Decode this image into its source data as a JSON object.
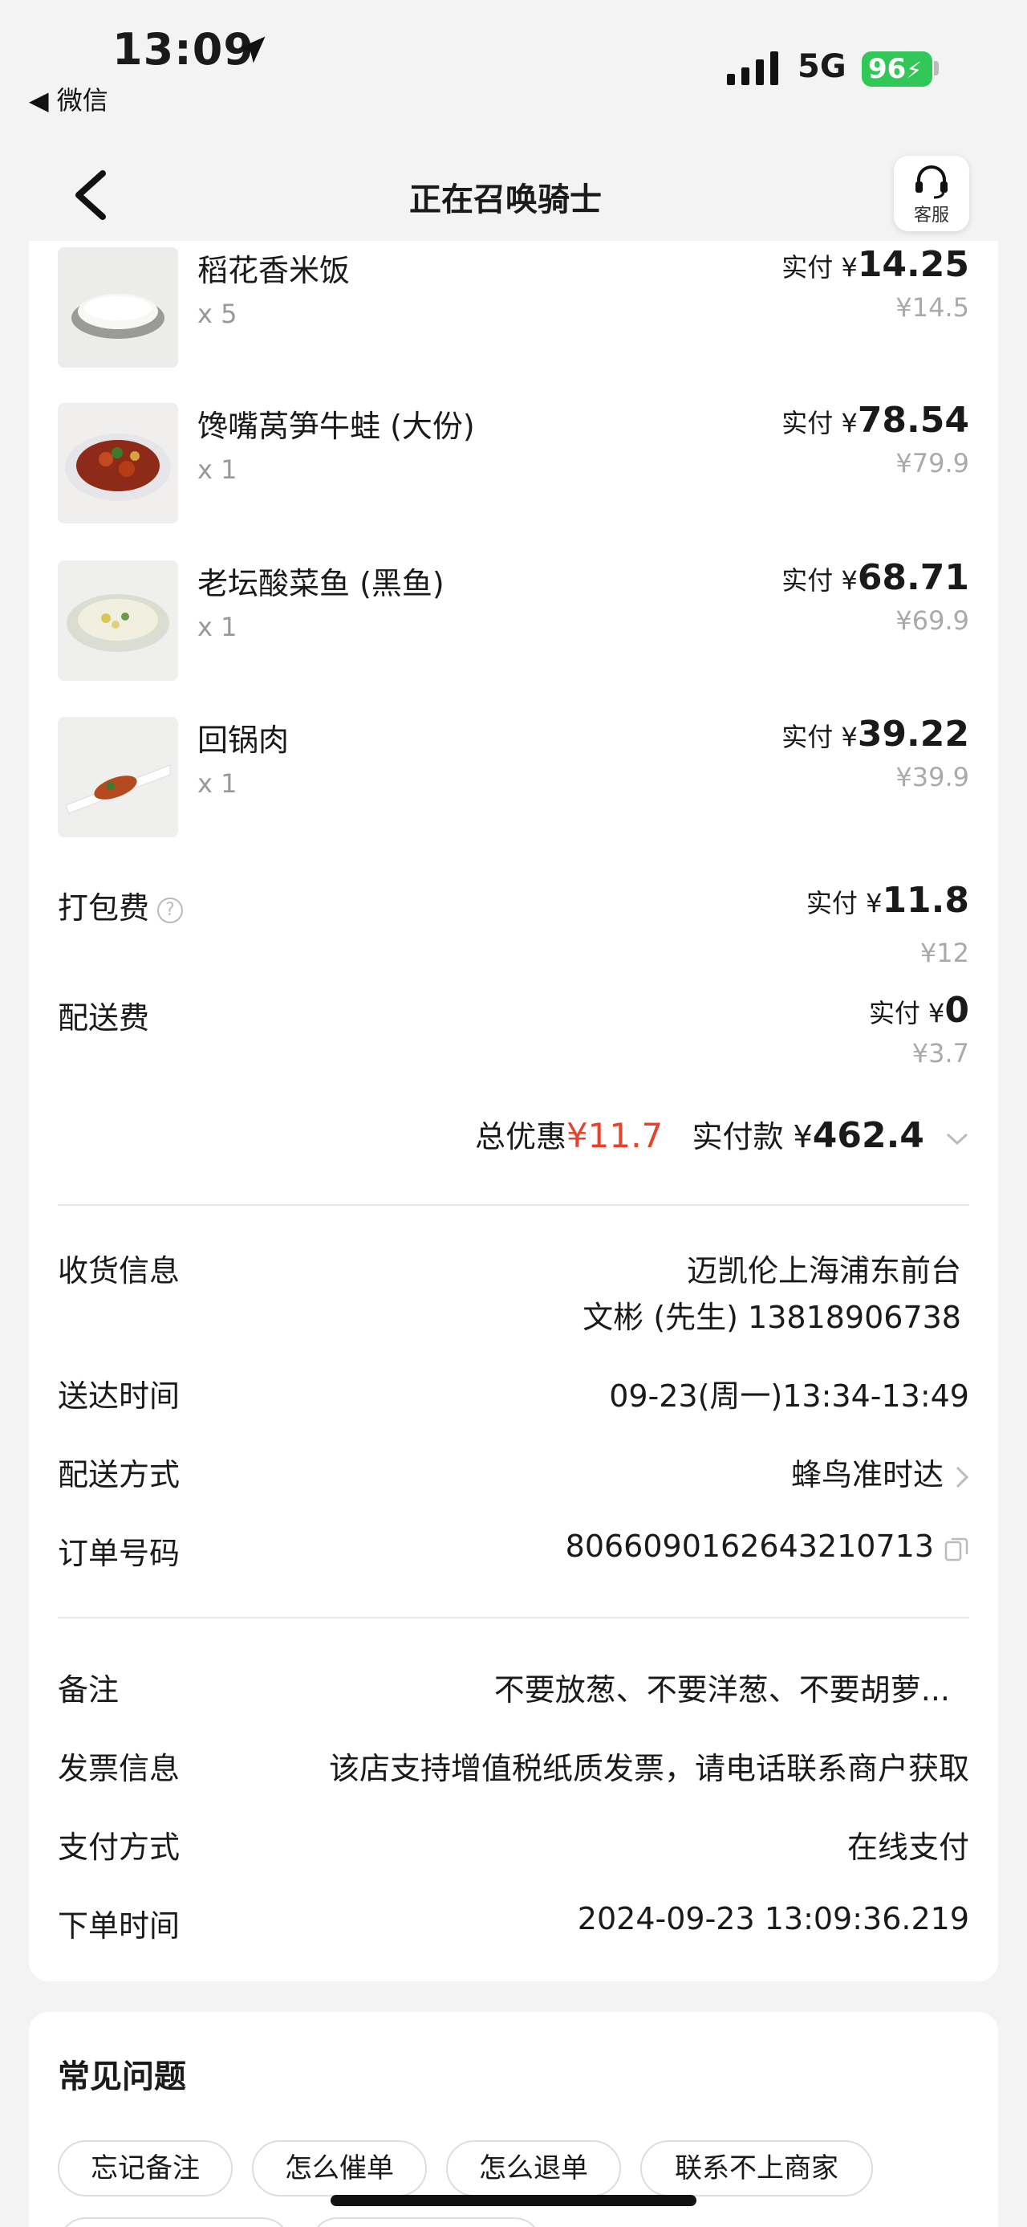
{
  "status_bar": {
    "time": "13:09",
    "back_app": "◀ 微信",
    "network": "5G",
    "battery": "96"
  },
  "nav": {
    "title": "正在召唤骑士",
    "service_label": "客服"
  },
  "items": [
    {
      "name": "稻花香米饭",
      "qty": "x 5",
      "pay_label": "实付 ¥",
      "pay_value": "14.25",
      "original": "¥14.5"
    },
    {
      "name": "馋嘴莴笋牛蛙 (大份)",
      "qty": "x 1",
      "pay_label": "实付 ¥",
      "pay_value": "78.54",
      "original": "¥79.9"
    },
    {
      "name": "老坛酸菜鱼 (黑鱼)",
      "qty": "x 1",
      "pay_label": "实付 ¥",
      "pay_value": "68.71",
      "original": "¥69.9"
    },
    {
      "name": "回锅肉",
      "qty": "x 1",
      "pay_label": "实付 ¥",
      "pay_value": "39.22",
      "original": "¥39.9"
    }
  ],
  "fees": {
    "packaging": {
      "label": "打包费",
      "help": "?",
      "pay_label": "实付 ¥",
      "pay_value": "11.8",
      "original": "¥12"
    },
    "delivery": {
      "label": "配送费",
      "pay_label": "实付 ¥",
      "pay_value": "0",
      "original": "¥3.7"
    }
  },
  "summary": {
    "discount_label": "总优惠",
    "discount_amount": "¥11.7",
    "paid_label": "实付款 ¥",
    "paid_amount": "462.4"
  },
  "order_info": {
    "address_label": "收货信息",
    "address_line1": "迈凯伦上海浦东前台",
    "address_line2": "文彬 (先生) 13818906738",
    "delivery_time_label": "送达时间",
    "delivery_time": "09-23(周一)13:34-13:49",
    "delivery_method_label": "配送方式",
    "delivery_method": "蜂鸟准时达",
    "order_no_label": "订单号码",
    "order_no": "8066090162643210713"
  },
  "extra_info": {
    "note_label": "备注",
    "note": "不要放葱、不要洋葱、不要胡萝...",
    "invoice_label": "发票信息",
    "invoice": "该店支持增值税纸质发票，请电话联系商户获取",
    "payment_label": "支付方式",
    "payment": "在线支付",
    "order_time_label": "下单时间",
    "order_time": "2024-09-23 13:09:36.219"
  },
  "faq": {
    "title": "常见问题",
    "chips": [
      "忘记备注",
      "怎么催单",
      "怎么退单",
      "联系不上商家"
    ]
  }
}
